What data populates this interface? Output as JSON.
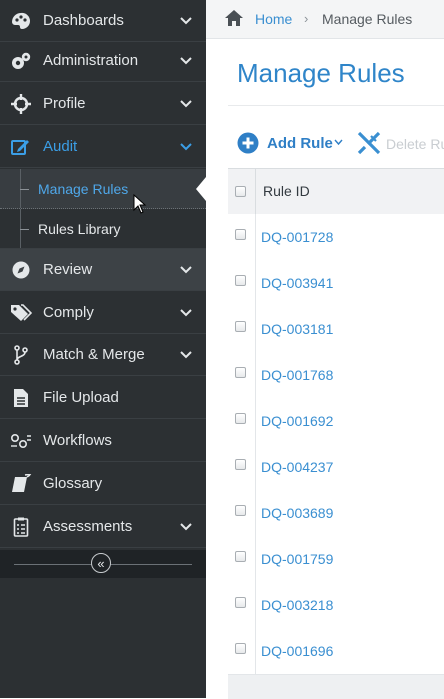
{
  "sidebar": {
    "items": [
      {
        "label": "Dashboards",
        "icon": "palette-icon"
      },
      {
        "label": "Administration",
        "icon": "gears-icon"
      },
      {
        "label": "Profile",
        "icon": "crosshair-icon"
      },
      {
        "label": "Audit",
        "icon": "edit-icon"
      },
      {
        "label": "Review",
        "icon": "compass-icon"
      },
      {
        "label": "Comply",
        "icon": "tags-icon"
      },
      {
        "label": "Match & Merge",
        "icon": "branch-icon"
      },
      {
        "label": "File Upload",
        "icon": "file-icon"
      },
      {
        "label": "Workflows",
        "icon": "workflow-icon"
      },
      {
        "label": "Glossary",
        "icon": "book-icon"
      },
      {
        "label": "Assessments",
        "icon": "checklist-icon"
      }
    ],
    "audit_sub": [
      {
        "label": "Manage Rules"
      },
      {
        "label": "Rules Library"
      }
    ],
    "collapse_symbol": "«"
  },
  "breadcrumb": {
    "home": "Home",
    "separator": "›",
    "current": "Manage Rules"
  },
  "page": {
    "title": "Manage Rules"
  },
  "toolbar": {
    "add_label": "Add Rule",
    "delete_label": "Delete Ru"
  },
  "grid": {
    "header": "Rule ID",
    "rows": [
      "DQ-001728",
      "DQ-003941",
      "DQ-003181",
      "DQ-001768",
      "DQ-001692",
      "DQ-004237",
      "DQ-003689",
      "DQ-001759",
      "DQ-003218",
      "DQ-001696"
    ]
  },
  "colors": {
    "sidebar_bg": "#2c3033",
    "accent": "#3b9ee6",
    "link": "#3a8fd1",
    "title": "#2f85c9"
  }
}
